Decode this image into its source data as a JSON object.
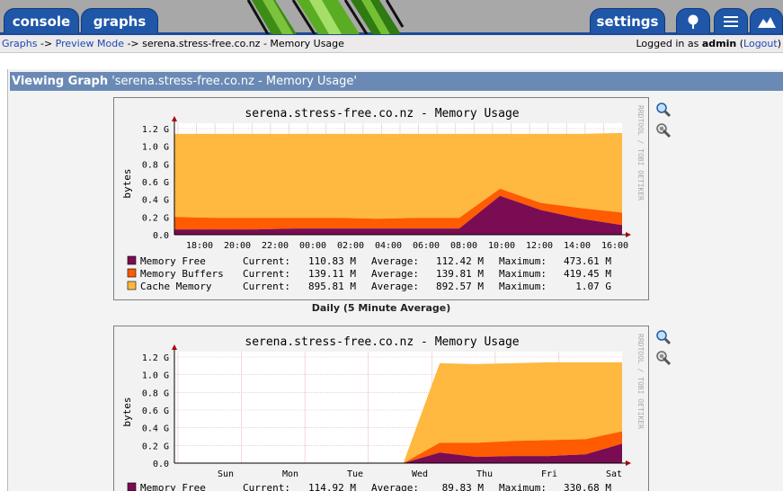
{
  "nav": {
    "console_label": "console",
    "graphs_label": "graphs",
    "settings_label": "settings"
  },
  "breadcrumb": {
    "graphs": "Graphs",
    "sep1": " -> ",
    "preview": "Preview Mode",
    "sep2": " -> ",
    "current": "serena.stress-free.co.nz - Memory Usage"
  },
  "login": {
    "prefix": "Logged in as ",
    "user": "admin",
    "logout_open": " (",
    "logout": "Logout",
    "logout_close": ")"
  },
  "panel": {
    "title_bold": "Viewing Graph",
    "title_rest": " 'serena.stress-free.co.nz - Memory Usage'"
  },
  "colors": {
    "memory_free": "#7a0c53",
    "memory_buffers": "#ff5b00",
    "cache_memory": "#ffb840",
    "accent": "#1f56a8"
  },
  "graphs": [
    {
      "title": "serena.stress-free.co.nz - Memory Usage",
      "ylabel": "bytes",
      "watermark": "RRDTOOL / TOBI OETIKER",
      "caption": "Daily (5 Minute Average)",
      "legend": [
        {
          "name": "Memory Free",
          "current": "110.83 M",
          "average": "112.42 M",
          "maximum": "473.61 M"
        },
        {
          "name": "Memory Buffers",
          "current": "139.11 M",
          "average": "139.81 M",
          "maximum": "419.45 M"
        },
        {
          "name": "Cache Memory",
          "current": "895.81 M",
          "average": "892.57 M",
          "maximum": "1.07 G"
        }
      ]
    },
    {
      "title": "serena.stress-free.co.nz - Memory Usage",
      "ylabel": "bytes",
      "watermark": "RRDTOOL / TOBI OETIKER",
      "legend": [
        {
          "name": "Memory Free",
          "current": "114.92 M",
          "average": "89.83 M",
          "maximum": "330.68 M"
        }
      ]
    }
  ],
  "legend_labels": {
    "current": "Current:",
    "average": "Average:",
    "maximum": "Maximum:"
  },
  "chart_data": [
    {
      "type": "area",
      "title": "serena.stress-free.co.nz - Memory Usage",
      "ylabel": "bytes",
      "x": [
        "18:00",
        "20:00",
        "22:00",
        "00:00",
        "02:00",
        "04:00",
        "06:00",
        "08:00",
        "10:00",
        "12:00",
        "14:00",
        "16:00"
      ],
      "yticks": [
        "0.0",
        "0.2 G",
        "0.4 G",
        "0.6 G",
        "0.8 G",
        "1.0 G",
        "1.2 G"
      ],
      "ylim": [
        0,
        1.2
      ],
      "stacked": true,
      "series": [
        {
          "name": "Memory Free",
          "values": [
            0.06,
            0.06,
            0.06,
            0.07,
            0.07,
            0.07,
            0.07,
            0.07,
            0.44,
            0.28,
            0.18,
            0.11
          ]
        },
        {
          "name": "Memory Buffers",
          "values": [
            0.14,
            0.13,
            0.13,
            0.12,
            0.12,
            0.11,
            0.12,
            0.12,
            0.08,
            0.08,
            0.12,
            0.14
          ]
        },
        {
          "name": "Cache Memory",
          "values": [
            0.94,
            0.95,
            0.95,
            0.95,
            0.95,
            0.96,
            0.95,
            0.95,
            0.62,
            0.78,
            0.84,
            0.9
          ]
        }
      ]
    },
    {
      "type": "area",
      "title": "serena.stress-free.co.nz - Memory Usage",
      "ylabel": "bytes",
      "x": [
        "Sun",
        "Mon",
        "Tue",
        "Wed",
        "Thu",
        "Fri",
        "Sat"
      ],
      "yticks": [
        "0.0",
        "0.2 G",
        "0.4 G",
        "0.6 G",
        "0.8 G",
        "1.0 G",
        "1.2 G"
      ],
      "ylim": [
        0,
        1.2
      ],
      "stacked": true,
      "series": [
        {
          "name": "Memory Free",
          "values": [
            0,
            0,
            0,
            0,
            0.12,
            0.07,
            0.08,
            0.08,
            0.1,
            0.22
          ]
        },
        {
          "name": "Memory Buffers",
          "values": [
            0,
            0,
            0,
            0,
            0.11,
            0.16,
            0.17,
            0.18,
            0.17,
            0.14
          ]
        },
        {
          "name": "Cache Memory",
          "values": [
            0,
            0,
            0,
            0,
            0.9,
            0.89,
            0.88,
            0.88,
            0.87,
            0.78
          ]
        }
      ]
    }
  ]
}
